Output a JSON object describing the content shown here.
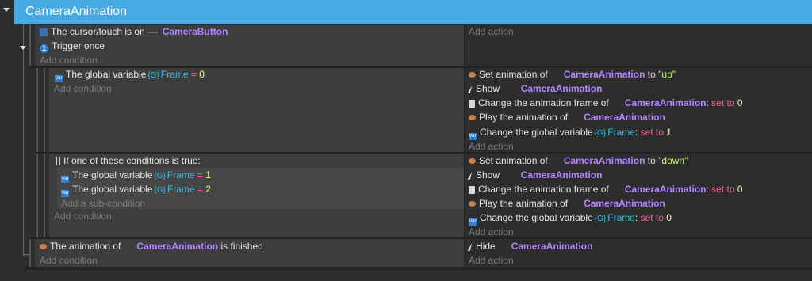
{
  "event_title": "CameraAnimation",
  "add_action": "Add action",
  "add_condition": "Add condition",
  "add_sub_condition": "Add a sub-condition",
  "event1": {
    "cond1_prefix": "The cursor/touch is on",
    "cond1_object": "CameraButton",
    "cond2_text": "Trigger once"
  },
  "sub1": {
    "cond_prefix": "The global variable",
    "cond_var": "Frame",
    "cond_op": "=",
    "cond_val": "0",
    "actions": {
      "a1_text": "Set animation of",
      "a1_obj": "CameraAnimation",
      "a1_to": "to",
      "a1_val": "\"up\"",
      "a2_text": "Show",
      "a2_obj": "CameraAnimation",
      "a3_text": "Change the animation frame of",
      "a3_obj": "CameraAnimation",
      "a3_setto": "set to",
      "a3_val": "0",
      "a4_text": "Play the animation of",
      "a4_obj": "CameraAnimation",
      "a5_text": "Change the global variable",
      "a5_var": "Frame",
      "a5_setto": "set to",
      "a5_val": "1"
    }
  },
  "sub2": {
    "or_title": "If one of these conditions is true:",
    "c1_prefix": "The global variable",
    "c1_var": "Frame",
    "c1_op": "=",
    "c1_val": "1",
    "c2_prefix": "The global variable",
    "c2_var": "Frame",
    "c2_op": "=",
    "c2_val": "2",
    "actions": {
      "a1_text": "Set animation of",
      "a1_obj": "CameraAnimation",
      "a1_to": "to",
      "a1_val": "\"down\"",
      "a2_text": "Show",
      "a2_obj": "CameraAnimation",
      "a3_text": "Change the animation frame of",
      "a3_obj": "CameraAnimation",
      "a3_setto": "set to",
      "a3_val": "0",
      "a4_text": "Play the animation of",
      "a4_obj": "CameraAnimation",
      "a5_text": "Change the global variable",
      "a5_var": "Frame",
      "a5_setto": "set to",
      "a5_val": "0"
    }
  },
  "event3": {
    "cond_prefix": "The animation of",
    "cond_obj": "CameraAnimation",
    "cond_suffix": "is finished",
    "a1_text": "Hide",
    "a1_obj": "CameraAnimation"
  },
  "colors": {
    "header": "#47a9e2",
    "object": "#b583ff",
    "variable": "#27c0ee",
    "number": "#f5f5a0",
    "string": "#c8f56a",
    "operator": "#ff5b8a"
  }
}
